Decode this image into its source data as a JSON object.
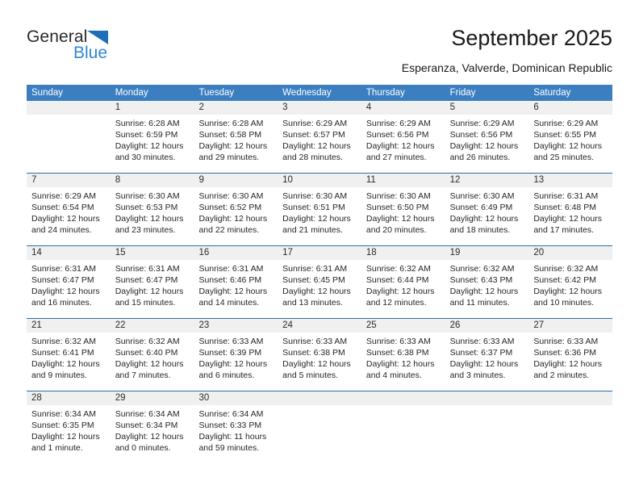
{
  "brand": {
    "word1": "General",
    "word2": "Blue",
    "triangle_icon": "triangle-icon",
    "colors": {
      "blue": "#2e86d4",
      "triangle": "#1e6fb8",
      "dark": "#2b2b2b"
    }
  },
  "header": {
    "title": "September 2025",
    "subtitle": "Esperanza, Valverde, Dominican Republic"
  },
  "theme": {
    "header_row_bg": "#3c7fc0",
    "week_divider": "#2e6da8",
    "date_band_bg": "#f0f0f0",
    "cell_bg": "#ffffff",
    "text": "#262626"
  },
  "weekday_headers": [
    "Sunday",
    "Monday",
    "Tuesday",
    "Wednesday",
    "Thursday",
    "Friday",
    "Saturday"
  ],
  "weeks": [
    {
      "dates": [
        "",
        "1",
        "2",
        "3",
        "4",
        "5",
        "6"
      ],
      "cells": [
        {
          "lines": []
        },
        {
          "lines": [
            "Sunrise: 6:28 AM",
            "Sunset: 6:59 PM",
            "Daylight: 12 hours",
            "and 30 minutes."
          ]
        },
        {
          "lines": [
            "Sunrise: 6:28 AM",
            "Sunset: 6:58 PM",
            "Daylight: 12 hours",
            "and 29 minutes."
          ]
        },
        {
          "lines": [
            "Sunrise: 6:29 AM",
            "Sunset: 6:57 PM",
            "Daylight: 12 hours",
            "and 28 minutes."
          ]
        },
        {
          "lines": [
            "Sunrise: 6:29 AM",
            "Sunset: 6:56 PM",
            "Daylight: 12 hours",
            "and 27 minutes."
          ]
        },
        {
          "lines": [
            "Sunrise: 6:29 AM",
            "Sunset: 6:56 PM",
            "Daylight: 12 hours",
            "and 26 minutes."
          ]
        },
        {
          "lines": [
            "Sunrise: 6:29 AM",
            "Sunset: 6:55 PM",
            "Daylight: 12 hours",
            "and 25 minutes."
          ]
        }
      ]
    },
    {
      "dates": [
        "7",
        "8",
        "9",
        "10",
        "11",
        "12",
        "13"
      ],
      "cells": [
        {
          "lines": [
            "Sunrise: 6:29 AM",
            "Sunset: 6:54 PM",
            "Daylight: 12 hours",
            "and 24 minutes."
          ]
        },
        {
          "lines": [
            "Sunrise: 6:30 AM",
            "Sunset: 6:53 PM",
            "Daylight: 12 hours",
            "and 23 minutes."
          ]
        },
        {
          "lines": [
            "Sunrise: 6:30 AM",
            "Sunset: 6:52 PM",
            "Daylight: 12 hours",
            "and 22 minutes."
          ]
        },
        {
          "lines": [
            "Sunrise: 6:30 AM",
            "Sunset: 6:51 PM",
            "Daylight: 12 hours",
            "and 21 minutes."
          ]
        },
        {
          "lines": [
            "Sunrise: 6:30 AM",
            "Sunset: 6:50 PM",
            "Daylight: 12 hours",
            "and 20 minutes."
          ]
        },
        {
          "lines": [
            "Sunrise: 6:30 AM",
            "Sunset: 6:49 PM",
            "Daylight: 12 hours",
            "and 18 minutes."
          ]
        },
        {
          "lines": [
            "Sunrise: 6:31 AM",
            "Sunset: 6:48 PM",
            "Daylight: 12 hours",
            "and 17 minutes."
          ]
        }
      ]
    },
    {
      "dates": [
        "14",
        "15",
        "16",
        "17",
        "18",
        "19",
        "20"
      ],
      "cells": [
        {
          "lines": [
            "Sunrise: 6:31 AM",
            "Sunset: 6:47 PM",
            "Daylight: 12 hours",
            "and 16 minutes."
          ]
        },
        {
          "lines": [
            "Sunrise: 6:31 AM",
            "Sunset: 6:47 PM",
            "Daylight: 12 hours",
            "and 15 minutes."
          ]
        },
        {
          "lines": [
            "Sunrise: 6:31 AM",
            "Sunset: 6:46 PM",
            "Daylight: 12 hours",
            "and 14 minutes."
          ]
        },
        {
          "lines": [
            "Sunrise: 6:31 AM",
            "Sunset: 6:45 PM",
            "Daylight: 12 hours",
            "and 13 minutes."
          ]
        },
        {
          "lines": [
            "Sunrise: 6:32 AM",
            "Sunset: 6:44 PM",
            "Daylight: 12 hours",
            "and 12 minutes."
          ]
        },
        {
          "lines": [
            "Sunrise: 6:32 AM",
            "Sunset: 6:43 PM",
            "Daylight: 12 hours",
            "and 11 minutes."
          ]
        },
        {
          "lines": [
            "Sunrise: 6:32 AM",
            "Sunset: 6:42 PM",
            "Daylight: 12 hours",
            "and 10 minutes."
          ]
        }
      ]
    },
    {
      "dates": [
        "21",
        "22",
        "23",
        "24",
        "25",
        "26",
        "27"
      ],
      "cells": [
        {
          "lines": [
            "Sunrise: 6:32 AM",
            "Sunset: 6:41 PM",
            "Daylight: 12 hours",
            "and 9 minutes."
          ]
        },
        {
          "lines": [
            "Sunrise: 6:32 AM",
            "Sunset: 6:40 PM",
            "Daylight: 12 hours",
            "and 7 minutes."
          ]
        },
        {
          "lines": [
            "Sunrise: 6:33 AM",
            "Sunset: 6:39 PM",
            "Daylight: 12 hours",
            "and 6 minutes."
          ]
        },
        {
          "lines": [
            "Sunrise: 6:33 AM",
            "Sunset: 6:38 PM",
            "Daylight: 12 hours",
            "and 5 minutes."
          ]
        },
        {
          "lines": [
            "Sunrise: 6:33 AM",
            "Sunset: 6:38 PM",
            "Daylight: 12 hours",
            "and 4 minutes."
          ]
        },
        {
          "lines": [
            "Sunrise: 6:33 AM",
            "Sunset: 6:37 PM",
            "Daylight: 12 hours",
            "and 3 minutes."
          ]
        },
        {
          "lines": [
            "Sunrise: 6:33 AM",
            "Sunset: 6:36 PM",
            "Daylight: 12 hours",
            "and 2 minutes."
          ]
        }
      ]
    },
    {
      "dates": [
        "28",
        "29",
        "30",
        "",
        "",
        "",
        ""
      ],
      "cells": [
        {
          "lines": [
            "Sunrise: 6:34 AM",
            "Sunset: 6:35 PM",
            "Daylight: 12 hours",
            "and 1 minute."
          ]
        },
        {
          "lines": [
            "Sunrise: 6:34 AM",
            "Sunset: 6:34 PM",
            "Daylight: 12 hours",
            "and 0 minutes."
          ]
        },
        {
          "lines": [
            "Sunrise: 6:34 AM",
            "Sunset: 6:33 PM",
            "Daylight: 11 hours",
            "and 59 minutes."
          ]
        },
        {
          "lines": []
        },
        {
          "lines": []
        },
        {
          "lines": []
        },
        {
          "lines": []
        }
      ]
    }
  ]
}
